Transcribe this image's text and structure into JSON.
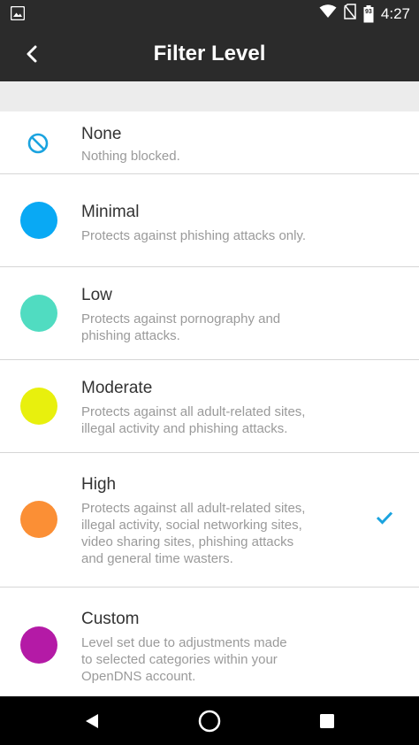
{
  "status_bar": {
    "time": "4:27",
    "icons": [
      "image-icon",
      "wifi-icon",
      "no-sim-icon",
      "battery-icon"
    ],
    "battery_label": "93"
  },
  "app_bar": {
    "title": "Filter Level",
    "back_icon": "chevron-left-icon"
  },
  "colors": {
    "bar_bg": "#2b2b2b",
    "accent": "#29a8e0",
    "minimal": "#09a9f4",
    "low": "#50dcc1",
    "moderate": "#e8f00d",
    "high": "#fb8f35",
    "custom": "#b41aa6"
  },
  "filter_levels": [
    {
      "title": "None",
      "description": "Nothing blocked.",
      "icon": "block-icon",
      "selected": false
    },
    {
      "title": "Minimal",
      "description": "Protects against phishing attacks only.",
      "icon": "blue-dot-icon",
      "selected": false
    },
    {
      "title": "Low",
      "description": "Protects against pornography and\nphishing attacks.",
      "icon": "teal-dot-icon",
      "selected": false
    },
    {
      "title": "Moderate",
      "description": "Protects against all adult-related sites,\nillegal activity and phishing attacks.",
      "icon": "yellow-dot-icon",
      "selected": false
    },
    {
      "title": "High",
      "description": "Protects against all adult-related sites,\nillegal activity, social networking sites,\nvideo sharing sites, phishing attacks\nand general time wasters.",
      "icon": "orange-dot-icon",
      "selected": true
    },
    {
      "title": "Custom",
      "description": "Level set due to adjustments made\nto selected categories within your\nOpenDNS account.",
      "icon": "purple-dot-icon",
      "selected": false
    }
  ],
  "nav_bar": {
    "icons": [
      "back-triangle-icon",
      "home-circle-icon",
      "recents-square-icon"
    ]
  }
}
